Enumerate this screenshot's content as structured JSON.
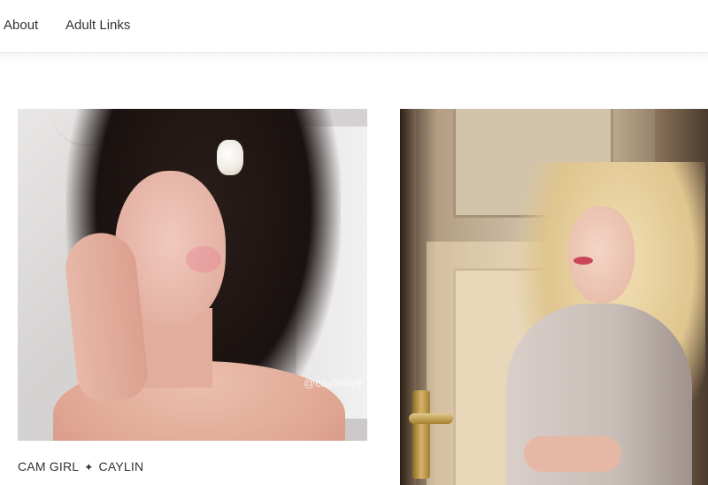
{
  "nav": {
    "about": "About",
    "adult_links": "Adult Links"
  },
  "cards": [
    {
      "caption_left": "CAM GIRL",
      "caption_sep": "✦",
      "caption_right": "CAYLIN",
      "watermark": "@caylinlive"
    },
    {
      "caption_left": "",
      "caption_right": ""
    }
  ],
  "colors": {
    "nav_text": "#333333",
    "border": "#e6e6e6",
    "background": "#ffffff"
  }
}
